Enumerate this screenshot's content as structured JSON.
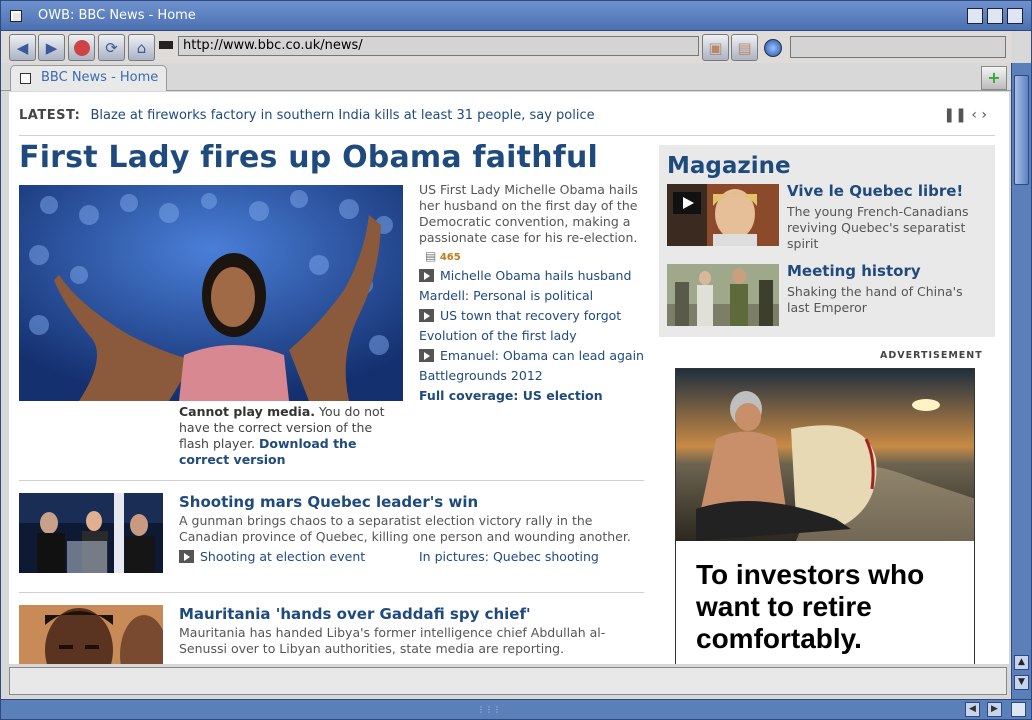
{
  "window": {
    "title": "OWB: BBC News - Home"
  },
  "toolbar": {
    "url": "http://www.bbc.co.uk/news/",
    "search_value": ""
  },
  "tabs": [
    {
      "label": "BBC News - Home"
    }
  ],
  "latest": {
    "label": "LATEST:",
    "text": "Blaze at fireworks factory in southern India kills at least 31 people, say police"
  },
  "top_story": {
    "headline": "First Lady fires up Obama faithful",
    "summary": "US First Lady Michelle Obama hails her husband on the first day of the Democratic convention, making a passionate case for his re-election.",
    "comments": "465",
    "media_error_bold": "Cannot play media.",
    "media_error_text": "You do not have the correct version of the flash player.",
    "media_error_link": "Download the correct version",
    "related": [
      {
        "label": "Michelle Obama hails husband",
        "video": true
      },
      {
        "label": "Mardell: Personal is political",
        "video": false
      },
      {
        "label": "US town that recovery forgot",
        "video": true
      },
      {
        "label": "Evolution of the first lady",
        "video": false
      },
      {
        "label": "Emanuel: Obama can lead again",
        "video": true
      },
      {
        "label": "Battlegrounds 2012",
        "video": false
      },
      {
        "label": "Full coverage: US election",
        "video": false,
        "bold": true
      }
    ]
  },
  "stories": [
    {
      "headline": "Shooting mars Quebec leader's win",
      "summary": "A gunman brings chaos to a separatist election victory rally in the Canadian province of Quebec, killing one person and wounding another.",
      "link1": "Shooting at election event",
      "link2": "In pictures: Quebec shooting"
    },
    {
      "headline": "Mauritania 'hands over Gaddafi spy chief'",
      "summary": "Mauritania has handed Libya's former intelligence chief Abdullah al-Senussi over to Libyan authorities, state media are reporting."
    }
  ],
  "magazine": {
    "title": "Magazine",
    "items": [
      {
        "headline": "Vive le Quebec libre!",
        "summary": "The young French-Canadians reviving Quebec's separatist spirit"
      },
      {
        "headline": "Meeting history",
        "summary": "Shaking the hand of China's last Emperor"
      }
    ]
  },
  "advert": {
    "label": "ADVERTISEMENT",
    "copy": "To investors who want to retire comfortably."
  }
}
